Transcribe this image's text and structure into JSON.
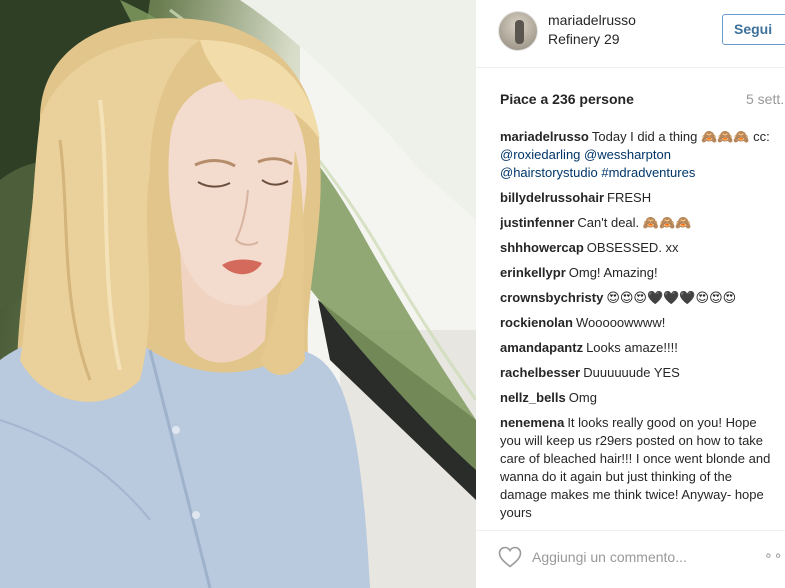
{
  "post": {
    "photo_icon": "photo",
    "author": {
      "username": "mariadelrusso",
      "location": "Refinery 29",
      "avatar_icon": "avatar"
    },
    "follow_label": "Segui",
    "likes": "Piace a 236 persone",
    "time": "5 sett.",
    "comments": [
      {
        "author": "mariadelrusso",
        "parts": [
          {
            "t": "Today I did a thing 🙈🙈🙈 cc: "
          },
          {
            "t": "@roxiedarling",
            "m": true
          },
          {
            "t": " "
          },
          {
            "t": "@wessharpton",
            "m": true
          },
          {
            "t": " "
          },
          {
            "t": "@hairstorystudio",
            "m": true
          },
          {
            "t": " "
          },
          {
            "t": "#mdradventures",
            "m": true
          }
        ]
      },
      {
        "author": "billydelrussohair",
        "parts": [
          {
            "t": "FRESH"
          }
        ]
      },
      {
        "author": "justinfenner",
        "parts": [
          {
            "t": "Can't deal. 🙈🙈🙈"
          }
        ]
      },
      {
        "author": "shhhowercap",
        "parts": [
          {
            "t": "OBSESSED. xx"
          }
        ]
      },
      {
        "author": "erinkellypr",
        "parts": [
          {
            "t": "Omg! Amazing!"
          }
        ]
      },
      {
        "author": "crownsbychristy",
        "parts": [
          {
            "t": "😍😍😍🖤🖤🖤😍😍😍"
          }
        ]
      },
      {
        "author": "rockienolan",
        "parts": [
          {
            "t": "Wooooowwww!"
          }
        ]
      },
      {
        "author": "amandapantz",
        "parts": [
          {
            "t": "Looks amaze!!!!"
          }
        ]
      },
      {
        "author": "rachelbesser",
        "parts": [
          {
            "t": "Duuuuuude YES"
          }
        ]
      },
      {
        "author": "nellz_bells",
        "parts": [
          {
            "t": "Omg"
          }
        ]
      },
      {
        "author": "nenemena",
        "parts": [
          {
            "t": "It looks really good on you! Hope you will keep us r29ers posted on how to take care of bleached hair!!! I once went blonde and wanna do it again but just thinking of the damage makes me think twice! Anyway- hope yours"
          }
        ]
      }
    ],
    "comment_placeholder": "Aggiungi un commento...",
    "like_icon": "heart",
    "more_icon": "more-options",
    "more_glyph": "∘∘∘",
    "colors": {
      "accent": "#3f729b",
      "mention": "#003569",
      "muted": "#999999",
      "divider": "#efefef"
    }
  }
}
